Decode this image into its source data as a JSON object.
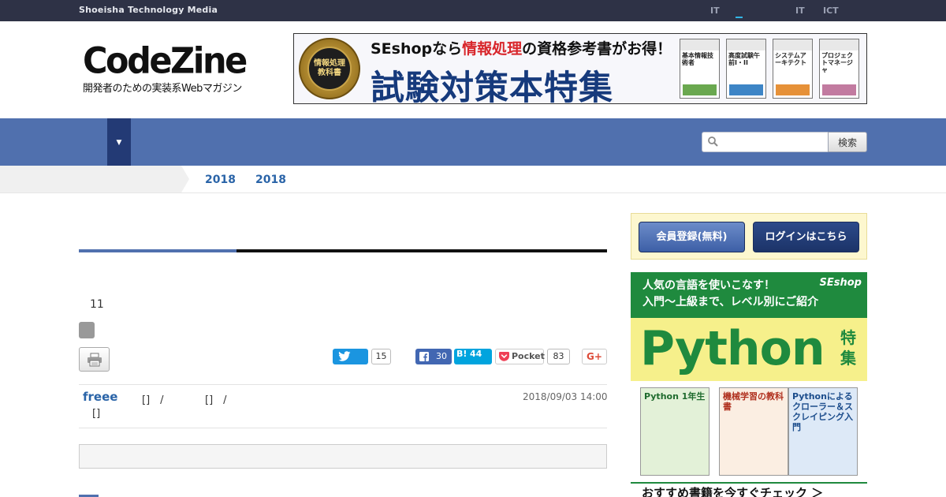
{
  "topbar": {
    "brand": "Shoeisha Technology Media",
    "links": [
      "IT",
      "IT",
      "ICT"
    ]
  },
  "header": {
    "logo_word": "CodeZine",
    "logo_tagline": "開発者のための実装系Webマガジン",
    "ad": {
      "seal_text": "情報処理 教科書",
      "line1_prefix": "SEshopなら",
      "line1_red": "情報処理",
      "line1_suffix": "の資格参考書がお得！",
      "line2": "試験対策本特集",
      "books": [
        "基本情報技術者",
        "高度試験午前I・II",
        "システムアーキテクト",
        "プロジェクトマネージャ"
      ]
    }
  },
  "nav": {
    "toggle_glyph": "▼",
    "search_placeholder": "",
    "search_button": "検索"
  },
  "breadcrumb": {
    "items": [
      "2018",
      "2018"
    ]
  },
  "article": {
    "page_number": "11",
    "share": {
      "twitter_count": "15",
      "facebook_count": "30",
      "hatena_label": "B!",
      "hatena_count": "44",
      "pocket_label": "Pocket",
      "pocket_count": "83",
      "gplus_label": "G+"
    },
    "author": "freee",
    "role_1": "[]　/",
    "role_2": "[]　/",
    "role_3": "[]",
    "date": "2018/09/03 14:00"
  },
  "sidebar": {
    "register_button": "会員登録(無料)",
    "login_button": "ログインはこちら",
    "python_ad": {
      "headline_1": "人気の言語を使いこなす！",
      "headline_2": "入門〜上級まで、レベル別にご紹介",
      "brand": "SEshop",
      "word": "Python",
      "suffix": "特集",
      "books": [
        "Python 1年生",
        "機械学習の教科書",
        "Pythonによるクローラー＆スクレイピング入門"
      ],
      "cta": "おすすめ書籍を今すぐチェック ＞"
    }
  },
  "colors": {
    "topbar": "#2e3246",
    "navbar": "#5070ae",
    "nav_toggle": "#233a75",
    "link_blue": "#2a64a8",
    "python_green": "#1f8a3e"
  }
}
